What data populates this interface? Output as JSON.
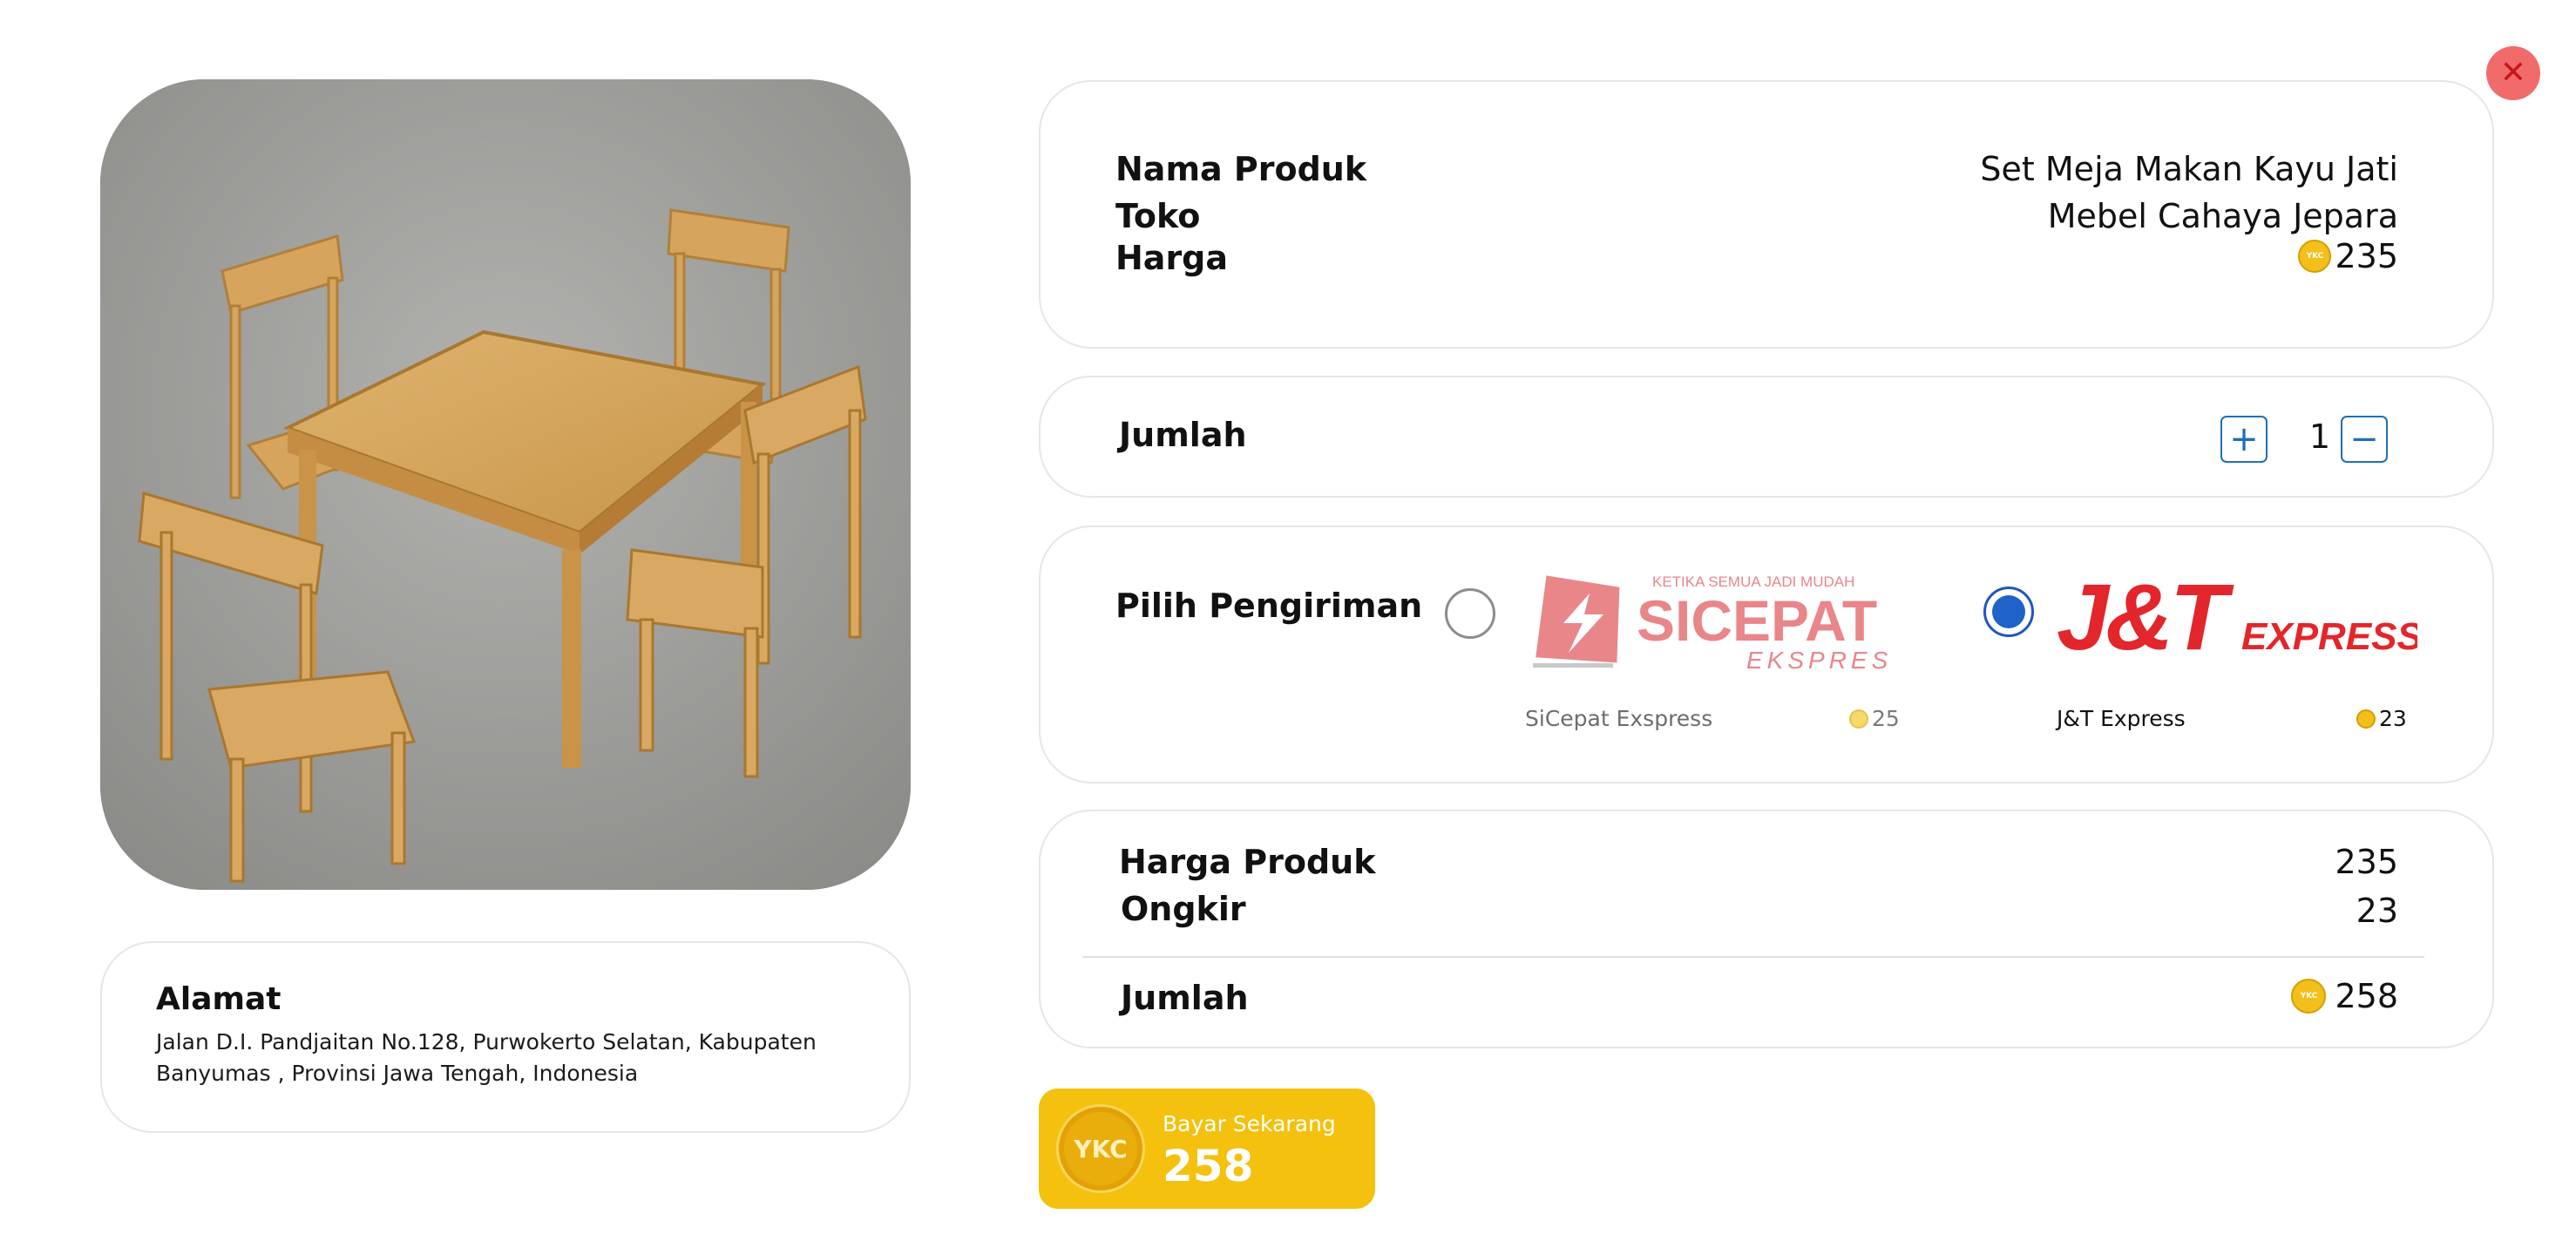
{
  "close": {
    "label": "✕"
  },
  "address": {
    "title": "Alamat",
    "text": "Jalan D.I. Pandjaitan No.128, Purwokerto Selatan, Kabupaten Banyumas , Provinsi Jawa Tengah, Indonesia"
  },
  "product": {
    "name_label": "Nama Produk",
    "name": "Set Meja Makan Kayu Jati",
    "store_label": "Toko",
    "store": "Mebel Cahaya Jepara",
    "price_label": "Harga",
    "price": "235",
    "coin_text": "YKC"
  },
  "quantity": {
    "label": "Jumlah",
    "value": "1",
    "plus": "+",
    "minus": "−"
  },
  "shipping": {
    "label": "Pilih Pengiriman",
    "options": [
      {
        "name": "SiCepat Exspress",
        "price": "25",
        "logo_brand": "SICEPAT",
        "logo_sub": "EKSPRES",
        "logo_tagline": "KETIKA SEMUA JADI MUDAH",
        "selected": false
      },
      {
        "name": "J&T Express",
        "price": "23",
        "logo_brand": "J&T",
        "logo_sub": "EXPRESS",
        "selected": true
      }
    ]
  },
  "summary": {
    "product_price_label": "Harga Produk",
    "product_price": "235",
    "shipping_label": "Ongkir",
    "shipping_price": "23",
    "total_label": "Jumlah",
    "total": "258"
  },
  "pay": {
    "label": "Bayar Sekarang",
    "amount": "258",
    "coin_text": "YKC"
  },
  "colors": {
    "accent_yellow": "#f3c10e",
    "radio_blue": "#1f63c9",
    "close_red": "#f26b6b",
    "sicepat_red": "#e8868a",
    "jnt_red": "#e3262b"
  }
}
